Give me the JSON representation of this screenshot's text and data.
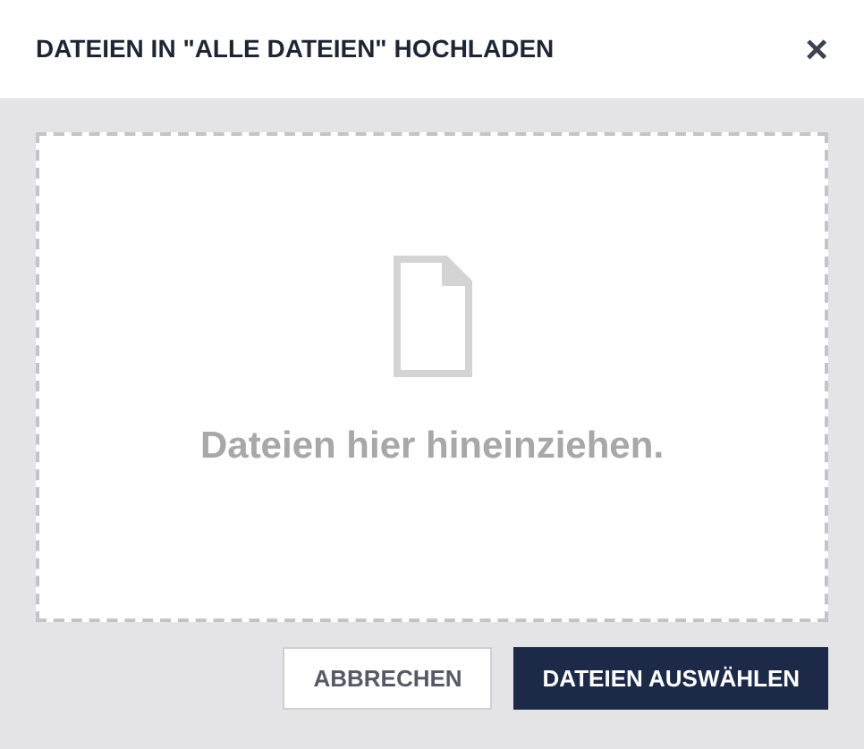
{
  "dialog": {
    "title": "DATEIEN IN \"ALLE DATEIEN\" HOCHLADEN",
    "close": "×"
  },
  "dropzone": {
    "hint": "Dateien hier hineinziehen."
  },
  "buttons": [
    {
      "label": "ABBRECHEN",
      "kind": "secondary"
    },
    {
      "label": "DATEIEN AUSWÄHLEN",
      "kind": "primary"
    }
  ]
}
